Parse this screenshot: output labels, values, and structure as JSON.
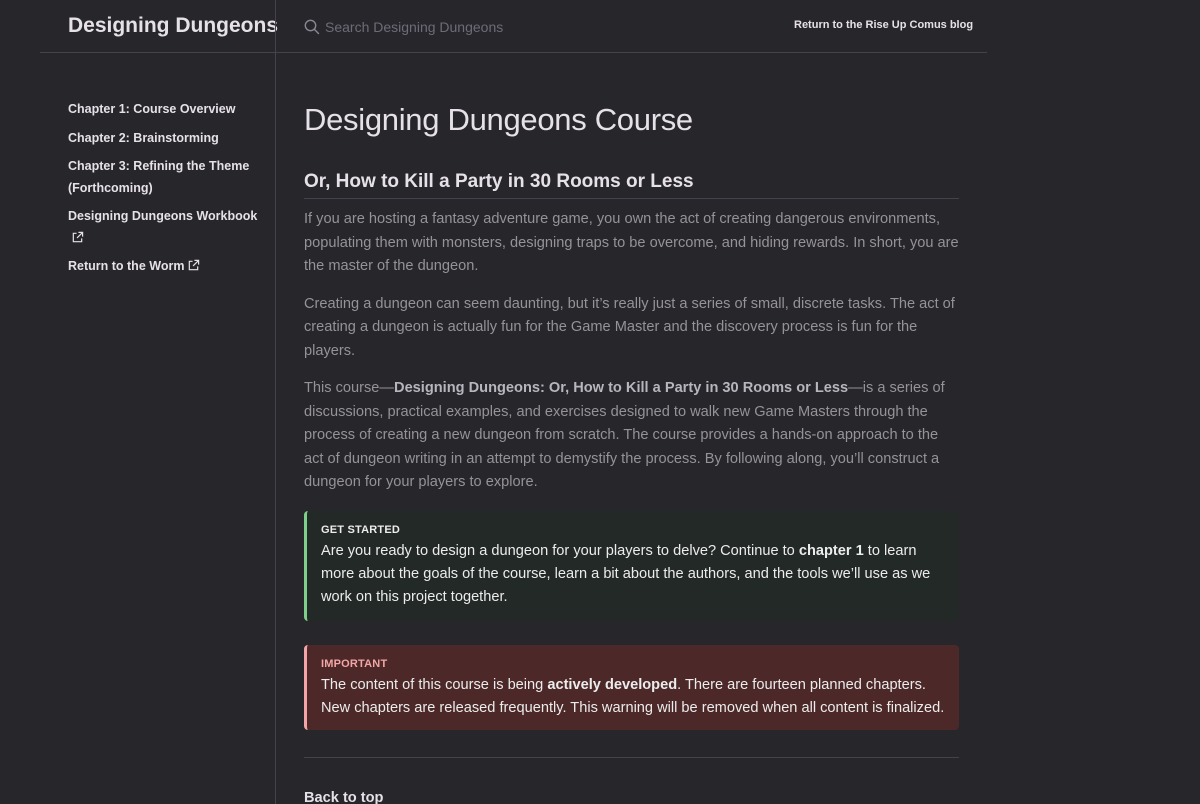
{
  "header": {
    "site_title": "Designing Dungeons",
    "search_placeholder": "Search Designing Dungeons",
    "aux_link": "Return to the Rise Up Comus blog"
  },
  "sidebar": {
    "items": [
      {
        "label": "Chapter 1: Course Overview",
        "external": false
      },
      {
        "label": "Chapter 2: Brainstorming",
        "external": false
      },
      {
        "label": "Chapter 3: Refining the Theme (Forthcoming)",
        "external": false
      },
      {
        "label": "Designing Dungeons Workbook",
        "external": true,
        "icon": "external-link-icon"
      },
      {
        "label": "Return to the Worm",
        "external": true,
        "icon": "external-link-icon"
      }
    ]
  },
  "main": {
    "title": "Designing Dungeons Course",
    "subtitle": "Or, How to Kill a Party in 30 Rooms or Less",
    "para1": "If you are hosting a fantasy adventure game, you own the act of creating dangerous environments, populating them with monsters, designing traps to be overcome, and hiding rewards. In short, you are the master of the dungeon.",
    "para2": "Creating a dungeon can seem daunting, but it’s really just a series of small, discrete tasks. The act of creating a dungeon is actually fun for the Game Master and the discovery process is fun for the players.",
    "para3": {
      "before": "This course—",
      "bold": "Designing Dungeons: Or, How to Kill a Party in 30 Rooms or Less",
      "after": "—is a series of discussions, practical examples, and exercises designed to walk new Game Masters through the process of creating a new dungeon from scratch. The course provides a hands-on approach to the act of dungeon writing in an attempt to demystify the process. By following along, you’ll construct a dungeon for your players to explore."
    },
    "callout_start": {
      "label": "GET STARTED",
      "before": "Are you ready to design a dungeon for your players to delve? Continue to ",
      "bold": "chapter 1",
      "after": " to learn more about the goals of the course, learn a bit about the authors, and the tools we’ll use as we work on this project together."
    },
    "callout_important": {
      "label": "IMPORTANT",
      "before": "The content of this course is being ",
      "bold": "actively developed",
      "after": ". There are fourteen planned chapters. New chapters are released frequently. This warning will be removed when all content is finalized."
    },
    "back_to_top": "Back to top"
  },
  "colors": {
    "background": "#27262b",
    "text": "#e6e1e8",
    "muted_text": "#959396",
    "callout_green_border": "#7ecf8c",
    "callout_red_bg": "#4c2828",
    "callout_red_border": "#f4a6a6"
  }
}
